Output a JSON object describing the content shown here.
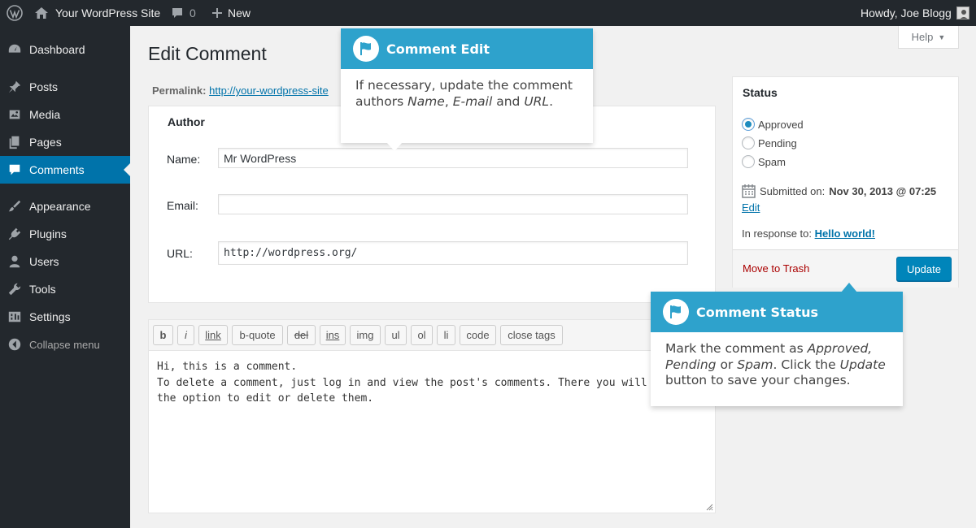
{
  "admin_bar": {
    "site_name": "Your WordPress Site",
    "comments_count": "0",
    "new_label": "New",
    "greeting": "Howdy, Joe Blogg"
  },
  "sidebar": {
    "items": [
      {
        "label": "Dashboard",
        "icon": "dashboard-icon"
      },
      {
        "label": "Posts",
        "icon": "pin-icon"
      },
      {
        "label": "Media",
        "icon": "media-icon"
      },
      {
        "label": "Pages",
        "icon": "pages-icon"
      },
      {
        "label": "Comments",
        "icon": "comment-icon"
      },
      {
        "label": "Appearance",
        "icon": "paintbrush-icon"
      },
      {
        "label": "Plugins",
        "icon": "plugin-icon"
      },
      {
        "label": "Users",
        "icon": "users-icon"
      },
      {
        "label": "Tools",
        "icon": "wrench-icon"
      },
      {
        "label": "Settings",
        "icon": "settings-icon"
      }
    ],
    "current": "Comments",
    "collapse_label": "Collapse menu"
  },
  "page": {
    "title": "Edit Comment",
    "help_label": "Help",
    "permalink_label": "Permalink:",
    "permalink_url": "http://your-wordpress-site"
  },
  "author_box": {
    "title": "Author",
    "name_label": "Name:",
    "name_value": "Mr WordPress",
    "email_label": "Email:",
    "email_value": "",
    "url_label": "URL:",
    "url_value": "http://wordpress.org/"
  },
  "editor": {
    "buttons": [
      "b",
      "i",
      "link",
      "b-quote",
      "del",
      "ins",
      "img",
      "ul",
      "ol",
      "li",
      "code",
      "close tags"
    ],
    "content": "Hi, this is a comment.\nTo delete a comment, just log in and view the post's comments. There you will\nthe option to edit or delete them."
  },
  "status_box": {
    "title": "Status",
    "options": [
      "Approved",
      "Pending",
      "Spam"
    ],
    "selected": "Approved",
    "submitted_label": "Submitted on:",
    "submitted_date": "Nov 30, 2013 @ 07:25",
    "edit_label": "Edit",
    "response_label": "In response to:",
    "response_link": "Hello world!",
    "trash_label": "Move to Trash",
    "update_label": "Update"
  },
  "pointers": {
    "comment_edit": {
      "title": "Comment Edit",
      "text_1": "If necessary, update the comment",
      "text_2a": "authors ",
      "text_2b": "Name",
      "text_2c": ", ",
      "text_2d": "E-mail",
      "text_2e": " and ",
      "text_2f": "URL",
      "text_2g": "."
    },
    "comment_status": {
      "title": "Comment Status",
      "text_1a": "Mark the comment as ",
      "text_1b": "Approved,",
      "text_2a": "Pending",
      "text_2b": " or ",
      "text_2c": "Spam",
      "text_2d": ". Click the ",
      "text_2e": "Update",
      "text_3": "button to save your changes."
    }
  },
  "colors": {
    "admin_dark": "#23282d",
    "accent_blue": "#0073aa",
    "pointer_blue": "#2ea2cc",
    "trash_red": "#a00"
  }
}
